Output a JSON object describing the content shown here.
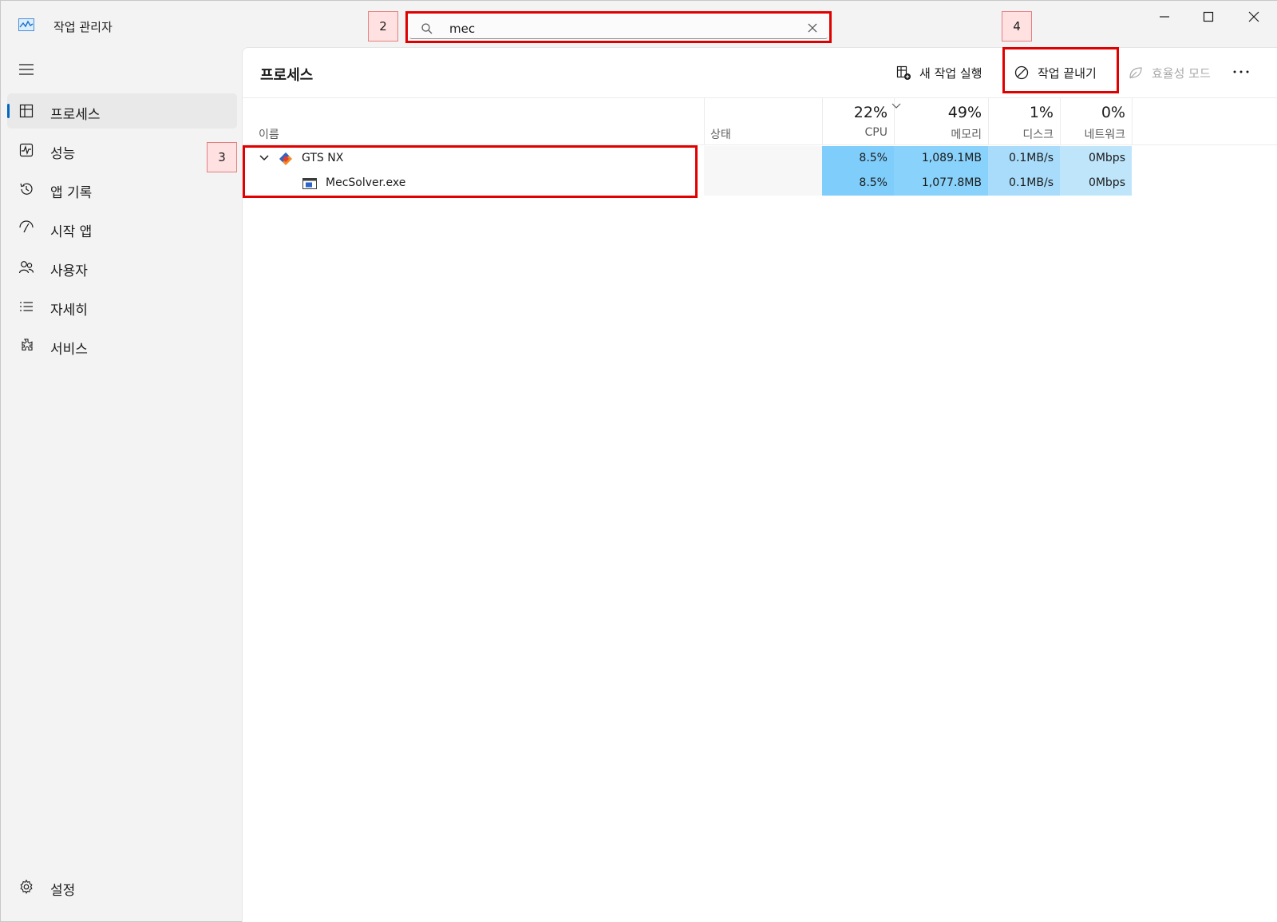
{
  "app": {
    "title": "작업 관리자"
  },
  "search": {
    "value": "mec"
  },
  "badges": {
    "search": "2",
    "process": "3",
    "end_task": "4"
  },
  "sidebar": {
    "items": [
      {
        "label": "프로세스",
        "icon": "processes-icon",
        "active": true
      },
      {
        "label": "성능",
        "icon": "performance-icon"
      },
      {
        "label": "앱 기록",
        "icon": "app-history-icon"
      },
      {
        "label": "시작 앱",
        "icon": "startup-apps-icon"
      },
      {
        "label": "사용자",
        "icon": "users-icon"
      },
      {
        "label": "자세히",
        "icon": "details-icon"
      },
      {
        "label": "서비스",
        "icon": "services-icon"
      }
    ],
    "settings_label": "설정"
  },
  "main": {
    "page_title": "프로세스",
    "toolbar": {
      "run_new_task": "새 작업 실행",
      "end_task": "작업 끝내기",
      "efficiency_mode": "효율성 모드"
    },
    "columns": {
      "name": "이름",
      "status": "상태",
      "cpu": {
        "pct": "22%",
        "label": "CPU"
      },
      "memory": {
        "pct": "49%",
        "label": "메모리"
      },
      "disk": {
        "pct": "1%",
        "label": "디스크"
      },
      "network": {
        "pct": "0%",
        "label": "네트워크"
      }
    },
    "rows": [
      {
        "name": "GTS NX",
        "cpu": "8.5%",
        "memory": "1,089.1MB",
        "disk": "0.1MB/s",
        "network": "0Mbps",
        "expanded": true
      },
      {
        "name": "MecSolver.exe",
        "cpu": "8.5%",
        "memory": "1,077.8MB",
        "disk": "0.1MB/s",
        "network": "0Mbps"
      }
    ]
  },
  "colors": {
    "accent": "#0067c0",
    "highlight_red": "#e00000",
    "cpu_fill": "#7fcdfb",
    "memory_fill": "#89d2fb",
    "disk_fill": "#a8dcfa",
    "network_fill": "#bfe5fb"
  }
}
